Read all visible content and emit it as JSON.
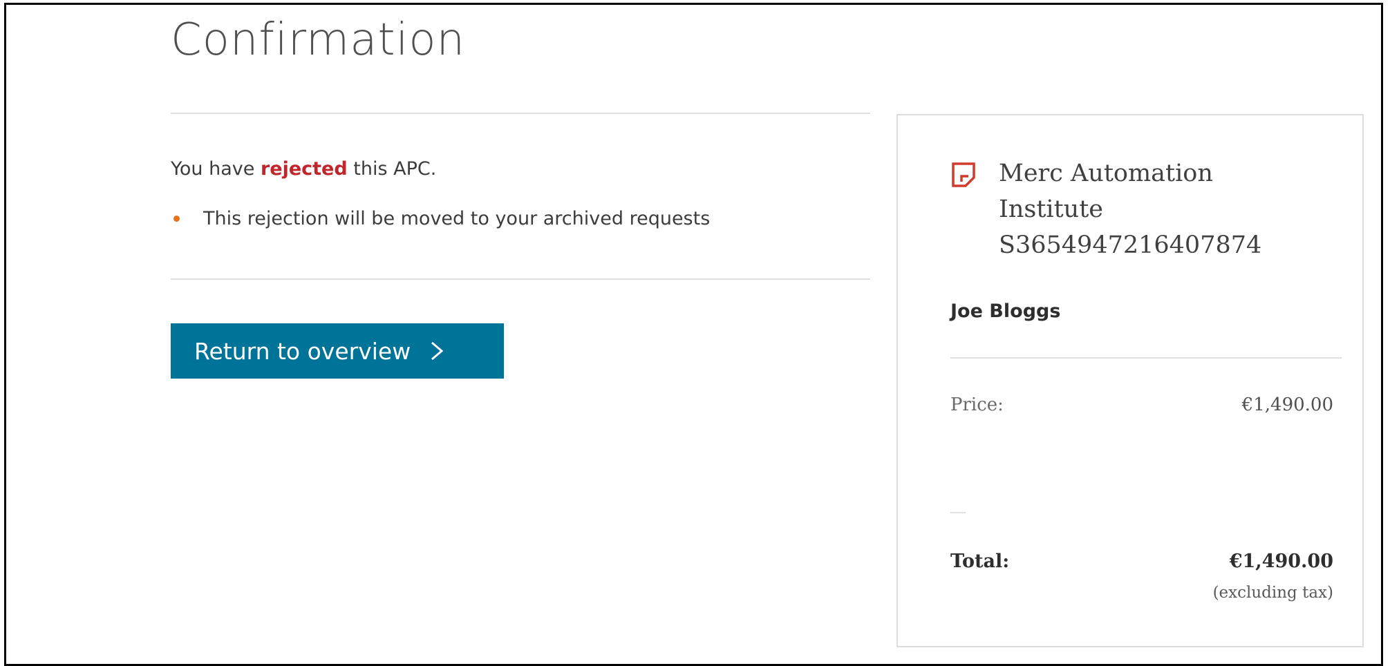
{
  "page": {
    "title": "Confirmation"
  },
  "message": {
    "prefix": "You have ",
    "status_word": "rejected",
    "suffix": " this APC.",
    "bullet": "This rejection will be moved to your archived requests"
  },
  "actions": {
    "return_label": "Return to overview"
  },
  "summary": {
    "org_name_line1": "Merc Automation",
    "org_name_line2": "Institute",
    "org_id": "S3654947216407874",
    "person": "Joe Bloggs",
    "price_label": "Price:",
    "price_value": "€1,490.00",
    "total_label": "Total:",
    "total_value": "€1,490.00",
    "tax_note": "(excluding tax)"
  },
  "colors": {
    "accent": "#007398",
    "rejected": "#c0262b",
    "bullet": "#e9711c",
    "icon": "#d03b2b"
  }
}
